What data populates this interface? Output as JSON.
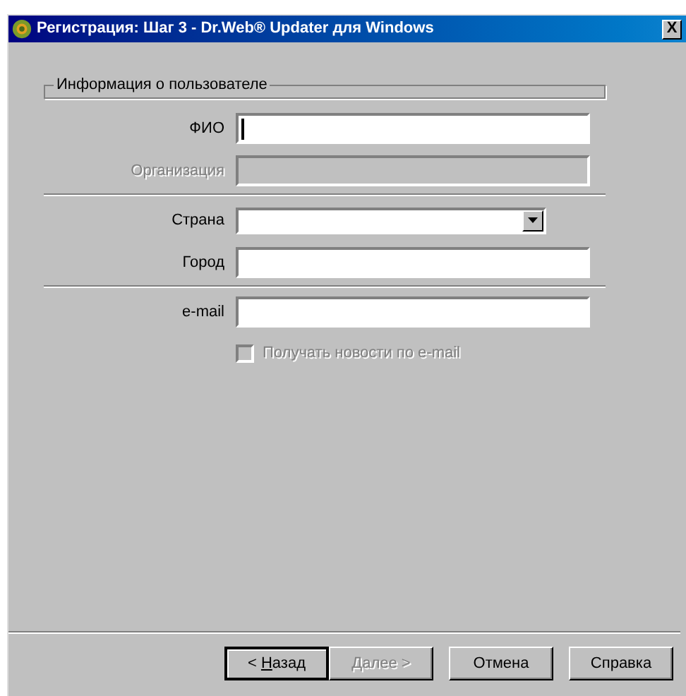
{
  "window": {
    "title": "Регистрация: Шаг 3 - Dr.Web® Updater для Windows",
    "close": "X"
  },
  "group": {
    "label": "Информация о пользователе"
  },
  "sections": [
    [
      {
        "kind": "text",
        "label": "ФИО",
        "disabled": false,
        "focused": true
      },
      {
        "kind": "text",
        "label": "Организация",
        "disabled": true
      }
    ],
    [
      {
        "kind": "combo",
        "label": "Страна",
        "disabled": false
      },
      {
        "kind": "text",
        "label": "Город",
        "disabled": false
      }
    ],
    [
      {
        "kind": "text",
        "label": "e-mail",
        "disabled": false
      },
      {
        "kind": "checkbox",
        "label": "Получать новости по e-mail",
        "disabled": true,
        "checked": false
      }
    ]
  ],
  "buttons": [
    {
      "before": "< ",
      "key": "Н",
      "after": "азад",
      "disabled": false,
      "default": true
    },
    {
      "key": "Д",
      "after": "алее >",
      "disabled": true,
      "default": false
    },
    {
      "after": "Отмена",
      "disabled": false,
      "default": false
    },
    {
      "after": "Справка",
      "disabled": false,
      "default": false
    }
  ]
}
